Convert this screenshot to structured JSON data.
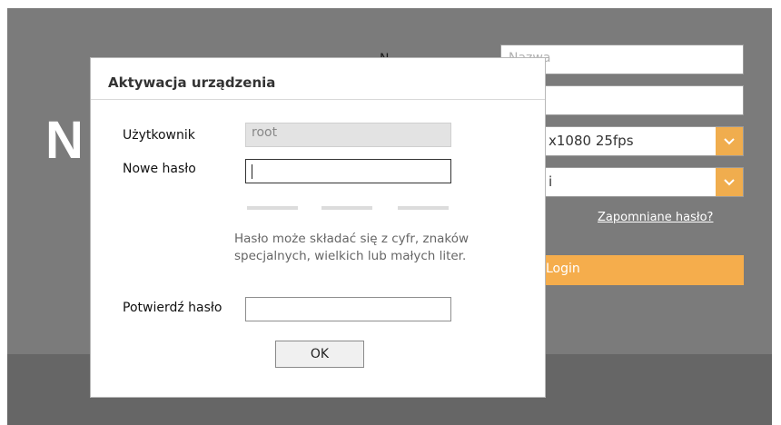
{
  "background": {
    "logo_text": "N",
    "name_label": "N",
    "username_placeholder": "Nazwa",
    "resolution_value": "x1080 25fps",
    "language_value": "i",
    "forgot_password_link": "Zapomniane hasło?",
    "login_button": "Login",
    "accent_color": "#f0ad4e"
  },
  "dialog": {
    "title": "Aktywacja urządzenia",
    "user_label": "Użytkownik",
    "user_value": "root",
    "new_password_label": "Nowe hasło",
    "new_password_value": "",
    "password_strength_segments": 3,
    "hint": "Hasło może składać się z cyfr, znaków specjalnych, wielkich lub małych liter.",
    "confirm_password_label": "Potwierdź hasło",
    "confirm_password_value": "",
    "ok_button": "OK"
  }
}
